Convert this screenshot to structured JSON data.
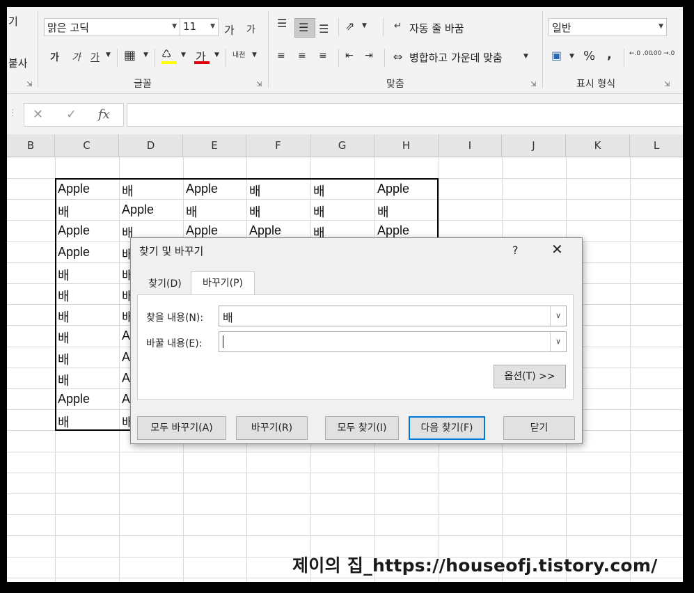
{
  "ribbon": {
    "left_labels": [
      "기",
      "붙사"
    ],
    "font_name": "맑은 고딕",
    "font_size": "11",
    "grow_font": "가",
    "shrink_font": "가",
    "bold": "가",
    "italic": "가",
    "underline": "가",
    "font_color_glyph": "가",
    "phonetic": "내천",
    "wrap_text": "자동 줄 바꿈",
    "merge_center": "병합하고 가운데 맞춤",
    "number_format": "일반",
    "percent": "%",
    "comma": ",",
    "inc_decimal": "←.0 .00",
    "dec_decimal": ".00 →.0",
    "group_font": "글꼴",
    "group_align": "맞춤",
    "group_number": "표시 형식"
  },
  "formula_bar": {
    "cancel": "✕",
    "enter": "✓",
    "fx": "fx",
    "value": ""
  },
  "columns": [
    "B",
    "C",
    "D",
    "E",
    "F",
    "G",
    "H",
    "I",
    "J",
    "K",
    "L"
  ],
  "sheet": {
    "rows": [
      [
        "Apple",
        "배",
        "Apple",
        "배",
        "배",
        "Apple"
      ],
      [
        "배",
        "Apple",
        "배",
        "배",
        "배",
        "배"
      ],
      [
        "Apple",
        "배",
        "Apple",
        "Apple",
        "배",
        "Apple"
      ],
      [
        "Apple",
        "배",
        "",
        "",
        "",
        ""
      ],
      [
        "배",
        "배",
        "",
        "",
        "",
        ""
      ],
      [
        "배",
        "배",
        "",
        "",
        "",
        ""
      ],
      [
        "배",
        "배",
        "",
        "",
        "",
        ""
      ],
      [
        "배",
        "A",
        "",
        "",
        "",
        ""
      ],
      [
        "배",
        "A",
        "",
        "",
        "",
        ""
      ],
      [
        "배",
        "A",
        "",
        "",
        "",
        ""
      ],
      [
        "Apple",
        "A",
        "",
        "",
        "",
        ""
      ],
      [
        "배",
        "배",
        "",
        "",
        "",
        ""
      ]
    ]
  },
  "dialog": {
    "title": "찾기 및 바꾸기",
    "help": "?",
    "close": "✕",
    "tabs": [
      "찾기(D)",
      "바꾸기(P)"
    ],
    "find_label": "찾을 내용(N):",
    "find_value": "배",
    "replace_label": "바꿀 내용(E):",
    "replace_value": "",
    "options_button": "옵션(T) >>",
    "buttons": {
      "replace_all": "모두 바꾸기(A)",
      "replace": "바꾸기(R)",
      "find_all": "모두 찾기(I)",
      "find_next": "다음 찾기(F)",
      "close": "닫기"
    }
  },
  "watermark": "제이의 집_https://houseofj.tistory.com/"
}
